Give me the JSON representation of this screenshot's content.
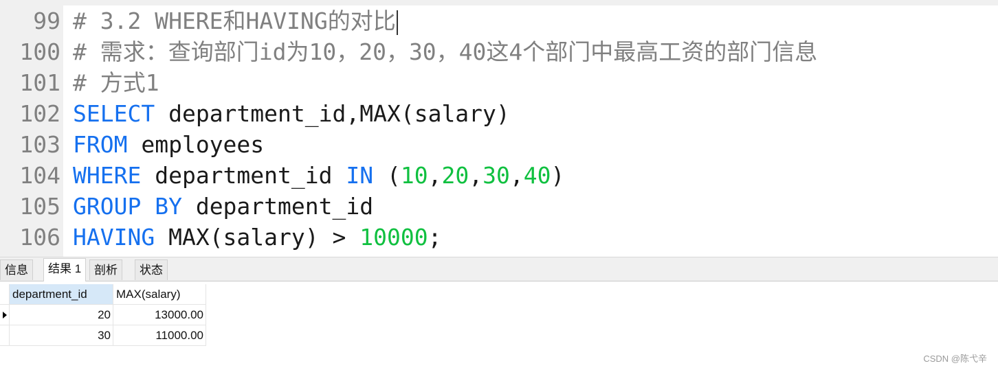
{
  "editor": {
    "lines": [
      {
        "no": "99",
        "segments": [
          {
            "t": "# 3.2 WHERE和HAVING的对比",
            "c": "comment"
          }
        ],
        "cursor": true
      },
      {
        "no": "100",
        "segments": [
          {
            "t": "# 需求：查询部门id为10，20，30，40这4个部门中最高工资的部门信息",
            "c": "comment"
          }
        ]
      },
      {
        "no": "101",
        "segments": [
          {
            "t": "# 方式1",
            "c": "comment"
          }
        ]
      },
      {
        "no": "102",
        "segments": [
          {
            "t": "SELECT",
            "c": "kw"
          },
          {
            "t": " department_id,MAX(salary)",
            "c": "plain"
          }
        ]
      },
      {
        "no": "103",
        "segments": [
          {
            "t": "FROM",
            "c": "kw"
          },
          {
            "t": " employees",
            "c": "plain"
          }
        ]
      },
      {
        "no": "104",
        "segments": [
          {
            "t": "WHERE",
            "c": "kw"
          },
          {
            "t": " department_id ",
            "c": "plain"
          },
          {
            "t": "IN",
            "c": "kw"
          },
          {
            "t": " (",
            "c": "plain"
          },
          {
            "t": "10",
            "c": "num"
          },
          {
            "t": ",",
            "c": "plain"
          },
          {
            "t": "20",
            "c": "num"
          },
          {
            "t": ",",
            "c": "plain"
          },
          {
            "t": "30",
            "c": "num"
          },
          {
            "t": ",",
            "c": "plain"
          },
          {
            "t": "40",
            "c": "num"
          },
          {
            "t": ")",
            "c": "plain"
          }
        ]
      },
      {
        "no": "105",
        "segments": [
          {
            "t": "GROUP BY",
            "c": "kw"
          },
          {
            "t": " department_id",
            "c": "plain"
          }
        ]
      },
      {
        "no": "106",
        "segments": [
          {
            "t": "HAVING",
            "c": "kw"
          },
          {
            "t": " MAX(salary) > ",
            "c": "plain"
          },
          {
            "t": "10000",
            "c": "num"
          },
          {
            "t": ";",
            "c": "plain"
          }
        ]
      }
    ]
  },
  "tabs": [
    {
      "label": "信息",
      "active": false
    },
    {
      "label": "结果 1",
      "active": true
    },
    {
      "label": "剖析",
      "active": false
    },
    {
      "label": "状态",
      "active": false
    }
  ],
  "result": {
    "columns": [
      "department_id",
      "MAX(salary)"
    ],
    "rows": [
      [
        "20",
        "13000.00"
      ],
      [
        "30",
        "11000.00"
      ]
    ],
    "current_row": 0
  },
  "watermark": "CSDN @陈弋辛"
}
